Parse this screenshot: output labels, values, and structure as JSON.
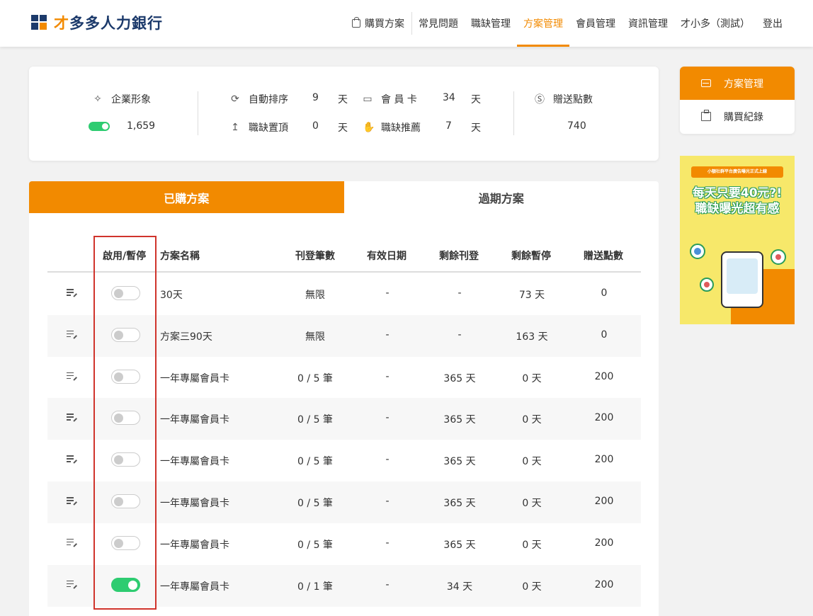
{
  "header": {
    "logo_accent": "才",
    "logo_rest": "多多人力銀行",
    "nav": [
      {
        "label": "購買方案",
        "active": false
      },
      {
        "label": "常見問題",
        "active": false
      },
      {
        "label": "職缺管理",
        "active": false
      },
      {
        "label": "方案管理",
        "active": true
      },
      {
        "label": "會員管理",
        "active": false
      },
      {
        "label": "資訊管理",
        "active": false
      },
      {
        "label": "才小多（測試）",
        "active": false
      },
      {
        "label": "登出",
        "active": false
      }
    ]
  },
  "summary": {
    "image_label": "企業形象",
    "image_value": "1,659",
    "auto_sort_label": "自動排序",
    "auto_sort_value": "9",
    "top_label": "職缺置頂",
    "top_value": "0",
    "day_unit": "天",
    "member_card_label": "會 員 卡",
    "member_card_value": "34",
    "recommend_label": "職缺推薦",
    "recommend_value": "7",
    "points_label": "贈送點數",
    "points_value": "740"
  },
  "tabs": [
    {
      "label": "已購方案",
      "active": true
    },
    {
      "label": "過期方案",
      "active": false
    }
  ],
  "table": {
    "headers": {
      "toggle": "啟用/暫停",
      "name": "方案名稱",
      "posts": "刊登筆數",
      "valid": "有效日期",
      "remain_post": "剩餘刊登",
      "remain_pause": "剩餘暫停",
      "points": "贈送點數"
    },
    "rows": [
      {
        "enabled": false,
        "name": "30天",
        "posts": "無限",
        "valid": "-",
        "remain_post": "-",
        "remain_pause": "73 天",
        "points": "0"
      },
      {
        "enabled": false,
        "name": "方案三90天",
        "posts": "無限",
        "valid": "-",
        "remain_post": "-",
        "remain_pause": "163 天",
        "points": "0"
      },
      {
        "enabled": false,
        "name": "一年專屬會員卡",
        "posts": "0 / 5 筆",
        "valid": "-",
        "remain_post": "365 天",
        "remain_pause": "0 天",
        "points": "200"
      },
      {
        "enabled": false,
        "name": "一年專屬會員卡",
        "posts": "0 / 5 筆",
        "valid": "-",
        "remain_post": "365 天",
        "remain_pause": "0 天",
        "points": "200"
      },
      {
        "enabled": false,
        "name": "一年專屬會員卡",
        "posts": "0 / 5 筆",
        "valid": "-",
        "remain_post": "365 天",
        "remain_pause": "0 天",
        "points": "200"
      },
      {
        "enabled": false,
        "name": "一年專屬會員卡",
        "posts": "0 / 5 筆",
        "valid": "-",
        "remain_post": "365 天",
        "remain_pause": "0 天",
        "points": "200"
      },
      {
        "enabled": false,
        "name": "一年專屬會員卡",
        "posts": "0 / 5 筆",
        "valid": "-",
        "remain_post": "365 天",
        "remain_pause": "0 天",
        "points": "200"
      },
      {
        "enabled": true,
        "name": "一年專屬會員卡",
        "posts": "0 / 1 筆",
        "valid": "-",
        "remain_post": "34 天",
        "remain_pause": "0 天",
        "points": "200"
      }
    ]
  },
  "side_menu": [
    {
      "label": "方案管理",
      "active": true
    },
    {
      "label": "購買紀錄",
      "active": false
    }
  ],
  "banner": {
    "top": "小額社群平台廣告曝光正式上線",
    "line1": "每天只要40元?!",
    "line2": "職缺曝光超有感"
  },
  "colors": {
    "accent": "#f28a00",
    "brand": "#1c3a6b",
    "toggle_on": "#2ecc71",
    "highlight": "#d0342c"
  }
}
